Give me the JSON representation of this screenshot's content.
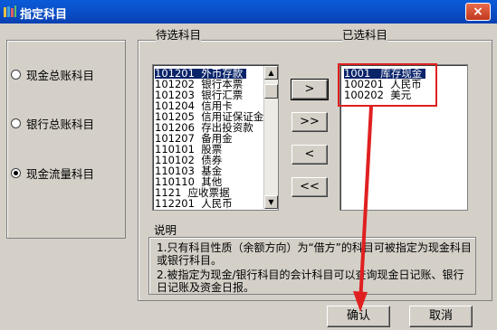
{
  "window": {
    "title": "指定科目",
    "close_label": "×"
  },
  "left_panel": {
    "options": [
      {
        "label": "现金总账科目",
        "checked": false
      },
      {
        "label": "银行总账科目",
        "checked": false
      },
      {
        "label": "现金流量科目",
        "checked": true
      }
    ]
  },
  "available": {
    "label": "待选科目",
    "items": [
      {
        "code": "101201",
        "name": "外币存款"
      },
      {
        "code": "101202",
        "name": "银行本票"
      },
      {
        "code": "101203",
        "name": "银行汇票"
      },
      {
        "code": "101204",
        "name": "信用卡"
      },
      {
        "code": "101205",
        "name": "信用证保证金"
      },
      {
        "code": "101206",
        "name": "存出投资款"
      },
      {
        "code": "101207",
        "name": "备用金"
      },
      {
        "code": "110101",
        "name": "股票"
      },
      {
        "code": "110102",
        "name": "债券"
      },
      {
        "code": "110103",
        "name": "基金"
      },
      {
        "code": "110110",
        "name": "其他"
      },
      {
        "code": "1121",
        "name": "应收票据"
      },
      {
        "code": "112201",
        "name": "人民币"
      }
    ]
  },
  "selected": {
    "label": "已选科目",
    "items": [
      {
        "code": "1001",
        "name": "库存现金"
      },
      {
        "code": "100201",
        "name": "人民币"
      },
      {
        "code": "100202",
        "name": "美元"
      }
    ]
  },
  "transfer_buttons": {
    "add_one": ">",
    "add_all": ">>",
    "remove_one": "<",
    "remove_all": "<<"
  },
  "description": {
    "label": "说明",
    "line1": "1.只有科目性质（余额方向）为“借方”的科目可被指定为现金科目或银行科目。",
    "line2": "2.被指定为现金/银行科目的会计科目可以查询现金日记账、银行日记账及资金日报。"
  },
  "footer": {
    "ok_label": "确认",
    "cancel_label": "取消"
  },
  "colors": {
    "selection": "#0a246a",
    "annotation": "#e02020",
    "titlebar": "#0a4cc4"
  }
}
